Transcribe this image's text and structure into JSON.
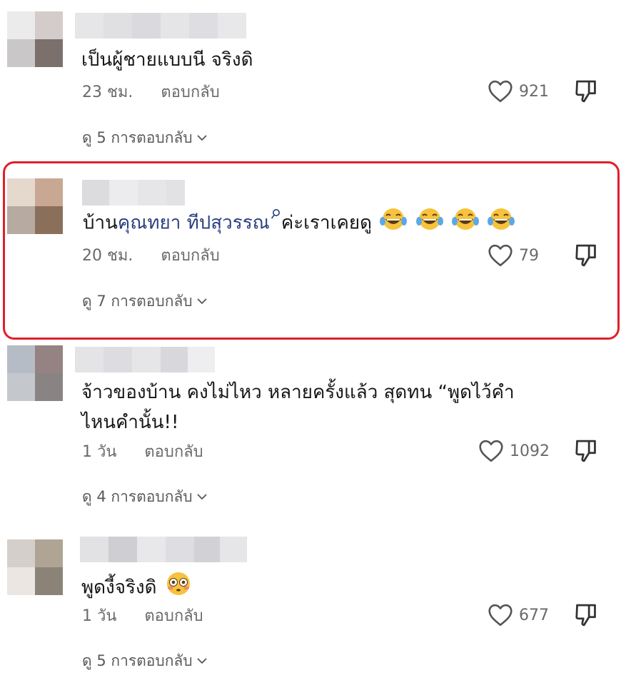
{
  "comments": [
    {
      "text": "เป็นผู้ชายแบบนี จริงดิ",
      "time": "23 ชม.",
      "reply_label": "ตอบกลับ",
      "likes": "921",
      "view_replies": "ดู 5 การตอบกลับ"
    },
    {
      "text_prefix": "บ้าน",
      "mention": "คุณทยา ทีปสุวรรณ",
      "text_suffix": "ค่ะเราเคยดู",
      "time": "20 ชม.",
      "reply_label": "ตอบกลับ",
      "likes": "79",
      "view_replies": "ดู 7 การตอบกลับ"
    },
    {
      "text_line1": "จ้าวของบ้าน คงไม่ไหว หลายครั้งแล้ว สุดทน “พูดไว้คำ",
      "text_line2": "ไหนคำนั้น!!",
      "time": "1 วัน",
      "reply_label": "ตอบกลับ",
      "likes": "1092",
      "view_replies": "ดู 4 การตอบกลับ"
    },
    {
      "text": "พูดงี้จริงดิ",
      "time": "1 วัน",
      "reply_label": "ตอบกลับ",
      "likes": "677",
      "view_replies": "ดู 5 การตอบกลับ"
    }
  ],
  "icons": {
    "like": "heart-outline-icon",
    "dislike": "thumbs-down-icon",
    "chevron": "chevron-down-icon",
    "emoji_laugh": "tears-of-joy-emoji",
    "emoji_flushed": "flushed-face-emoji"
  },
  "colors": {
    "mention": "#2a3f80",
    "highlight_border": "#e0202a",
    "meta_text": "#6a6a6a"
  }
}
